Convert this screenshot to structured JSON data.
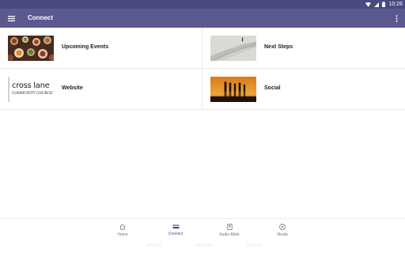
{
  "status_bar": {
    "time": "10:26",
    "icons": [
      "wifi-icon",
      "signal-icon",
      "battery-icon"
    ]
  },
  "app_bar": {
    "title": "Connect",
    "menu_icon": "hamburger-menu-icon",
    "more_icon": "more-vert-icon",
    "color": "#5a5a91"
  },
  "tiles": [
    {
      "label": "Upcoming Events",
      "image": "food-table-photo"
    },
    {
      "label": "Next Steps",
      "image": "staircase-photo"
    },
    {
      "label": "Website",
      "image": "crosslane-logo",
      "logo_line1": "cross lane",
      "logo_line2": "COMMUNITY CHURCH"
    },
    {
      "label": "Social",
      "image": "sunset-silhouettes-photo"
    }
  ],
  "bottom_nav": {
    "items": [
      {
        "label": "Home",
        "icon": "home-icon",
        "active": false
      },
      {
        "label": "Connect",
        "icon": "people-icon",
        "active": true
      },
      {
        "label": "Audio Bible",
        "icon": "book-icon",
        "active": false
      },
      {
        "label": "Media",
        "icon": "play-circle-icon",
        "active": false
      }
    ],
    "active_color": "#4b4a7e"
  }
}
